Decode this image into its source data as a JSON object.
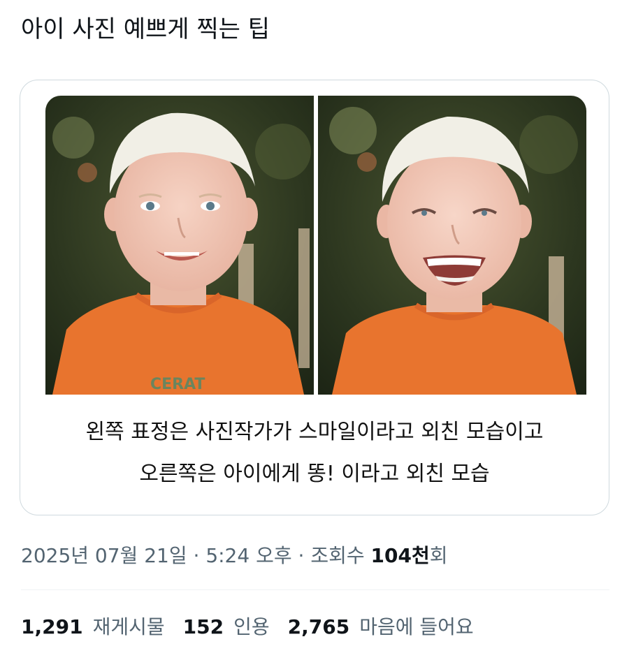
{
  "tweet": {
    "text": "아이 사진 예쁘게 찍는 팁",
    "media_caption_line1": "왼쪽 표정은 사진작가가 스마일이라고 외친 모습이고",
    "media_caption_line2": "오른쪽은 아이에게 똥! 이라고 외친 모습",
    "shirt_print": "CERAT"
  },
  "meta": {
    "date": "2025년 07월 21일",
    "sep1": " · ",
    "time": "5:24 오후",
    "sep2": " · ",
    "views_label": "조회수 ",
    "views_count": "104천",
    "views_suffix": "회"
  },
  "stats": {
    "retweets_count": "1,291",
    "retweets_label": "재게시물",
    "quotes_count": "152",
    "quotes_label": "인용",
    "likes_count": "2,765",
    "likes_label": "마음에 들어요"
  },
  "colors": {
    "text_primary": "#0f1419",
    "text_secondary": "#536471",
    "border": "#cfd9de",
    "shirt": "#e8742e",
    "hair": "#f1efe6",
    "background_foliage": "#2f3a22"
  }
}
